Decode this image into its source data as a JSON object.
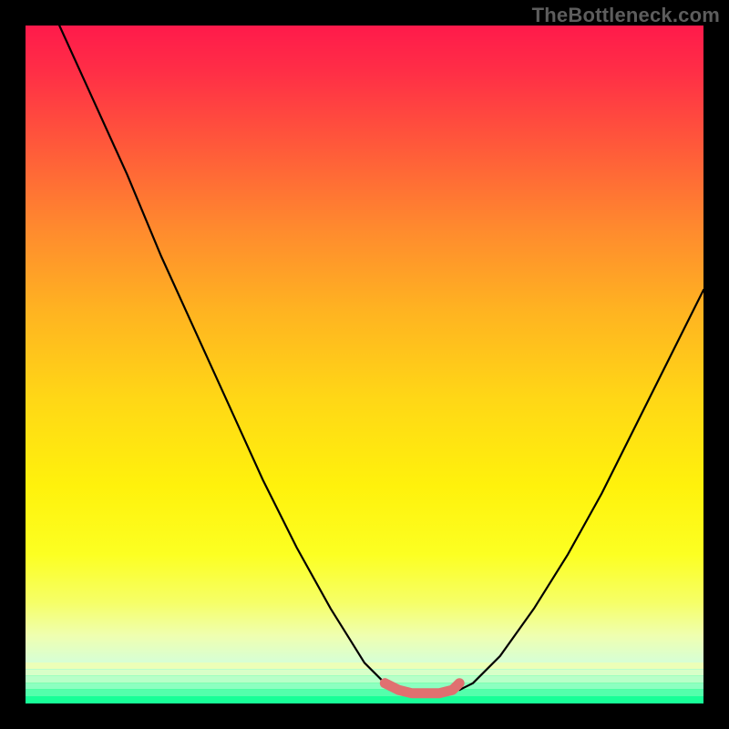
{
  "watermark": "TheBottleneck.com",
  "colors": {
    "frame": "#000000",
    "curve": "#000000",
    "trough": "#e07070",
    "gradient_top": "#ff1a4b",
    "gradient_bottom": "#00fa92"
  },
  "chart_data": {
    "type": "line",
    "title": "",
    "xlabel": "",
    "ylabel": "",
    "xlim": [
      0,
      100
    ],
    "ylim": [
      0,
      100
    ],
    "series": [
      {
        "name": "left-curve",
        "x": [
          5,
          10,
          15,
          20,
          25,
          30,
          35,
          40,
          45,
          50,
          53,
          55
        ],
        "values": [
          100,
          89,
          78,
          66,
          55,
          44,
          33,
          23,
          14,
          6,
          3,
          2
        ]
      },
      {
        "name": "right-curve",
        "x": [
          64,
          66,
          70,
          75,
          80,
          85,
          90,
          95,
          100
        ],
        "values": [
          2,
          3,
          7,
          14,
          22,
          31,
          41,
          51,
          61
        ]
      },
      {
        "name": "trough-highlight",
        "x": [
          53,
          55,
          57,
          59,
          61,
          63,
          64
        ],
        "values": [
          3,
          2,
          1.5,
          1.5,
          1.5,
          2,
          3
        ]
      }
    ],
    "background_gradient": {
      "orientation": "vertical",
      "stops": [
        {
          "pos": 0,
          "color": "#ff1a4b"
        },
        {
          "pos": 30,
          "color": "#ff8a2e"
        },
        {
          "pos": 55,
          "color": "#ffd716"
        },
        {
          "pos": 78,
          "color": "#fcff22"
        },
        {
          "pos": 94,
          "color": "#d6ffd6"
        },
        {
          "pos": 100,
          "color": "#00fa92"
        }
      ]
    },
    "bottom_bands": [
      {
        "y": 94.0,
        "h": 0.9,
        "color": "#ecffb8"
      },
      {
        "y": 95.0,
        "h": 0.9,
        "color": "#d8ffc8"
      },
      {
        "y": 96.0,
        "h": 0.9,
        "color": "#b8ffc8"
      },
      {
        "y": 97.0,
        "h": 0.9,
        "color": "#8cffc0"
      },
      {
        "y": 98.0,
        "h": 0.9,
        "color": "#54ffac"
      },
      {
        "y": 99.0,
        "h": 1.0,
        "color": "#18ff98"
      }
    ]
  }
}
